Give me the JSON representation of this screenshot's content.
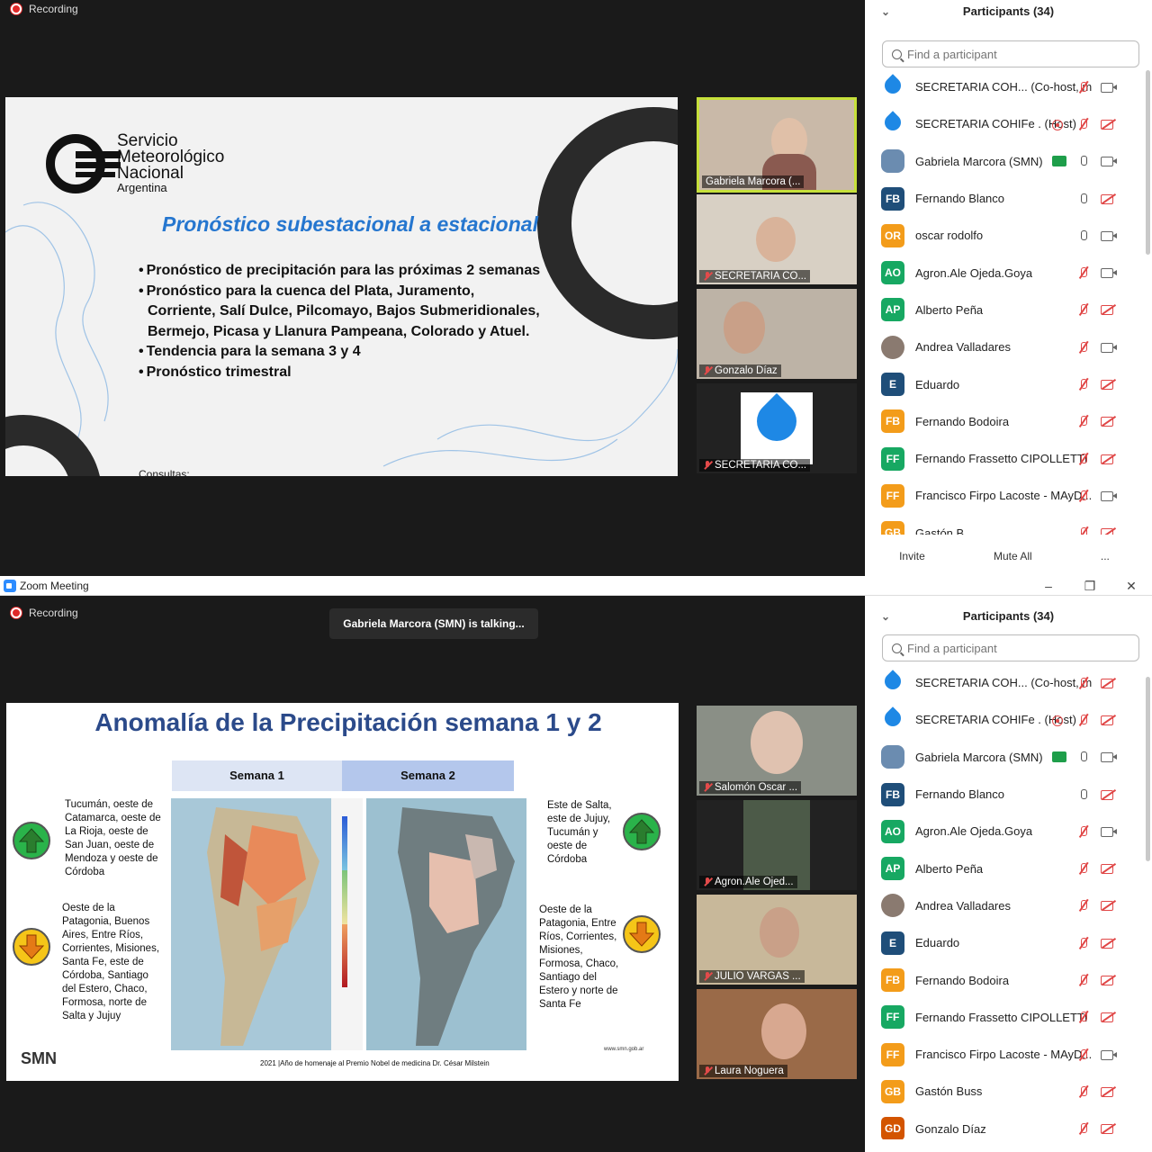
{
  "top": {
    "recording": "Recording",
    "slide": {
      "logo_lines": [
        "Servicio",
        "Meteorológico",
        "Nacional",
        "Argentina"
      ],
      "title": "Pronóstico subestacional a estacional",
      "bullets": [
        "Pronóstico de precipitación para las próximas 2 semanas",
        "Pronóstico para la cuenca del Plata, Juramento, Corriente, Salí Dulce, Pilcomayo, Bajos Submeridionales, Bermejo, Picasa y Llanura Pampeana, Colorado y Atuel.",
        "Tendencia para la semana 3 y 4",
        "Pronóstico trimestral"
      ],
      "footer": "Consultas: ..."
    },
    "tiles": [
      "Gabriela Marcora (...",
      "SECRETARIA CO...",
      "Gonzalo Díaz",
      "SECRETARIA CO..."
    ],
    "panel": {
      "title": "Participants (34)",
      "search_placeholder": "Find a participant",
      "participants": [
        {
          "initials": "",
          "name": "SECRETARIA COH... (Co-host, me)",
          "color": "#1e88e5",
          "avatar": "drop",
          "icons": [
            "micoff",
            "camon"
          ]
        },
        {
          "initials": "",
          "name": "SECRETARIA COHIFe . (Host)",
          "color": "#1e88e5",
          "avatar": "drop",
          "icons": [
            "recd",
            "micoff",
            "camoff"
          ]
        },
        {
          "initials": "",
          "name": "Gabriela Marcora (SMN)",
          "color": "#6b8cb0",
          "avatar": "photo2",
          "icons": [
            "share",
            "micon",
            "camon"
          ]
        },
        {
          "initials": "FB",
          "name": "Fernando Blanco",
          "color": "#1f4e79",
          "avatar": "",
          "icons": [
            "micon",
            "camoff"
          ]
        },
        {
          "initials": "OR",
          "name": "oscar rodolfo",
          "color": "#f39c1a",
          "avatar": "",
          "icons": [
            "micon",
            "camon"
          ]
        },
        {
          "initials": "AO",
          "name": "Agron.Ale Ojeda.Goya",
          "color": "#17a862",
          "avatar": "",
          "icons": [
            "micoff",
            "camon"
          ]
        },
        {
          "initials": "AP",
          "name": "Alberto Peña",
          "color": "#17a862",
          "avatar": "",
          "icons": [
            "micoff",
            "camoff"
          ]
        },
        {
          "initials": "",
          "name": "Andrea Valladares",
          "color": "#8a7a70",
          "avatar": "photo",
          "icons": [
            "micoff",
            "camon"
          ]
        },
        {
          "initials": "E",
          "name": "Eduardo",
          "color": "#1f4e79",
          "avatar": "",
          "icons": [
            "micoff",
            "camoff"
          ]
        },
        {
          "initials": "FB",
          "name": "Fernando Bodoira",
          "color": "#f39c1a",
          "avatar": "",
          "icons": [
            "micoff",
            "camoff"
          ]
        },
        {
          "initials": "FF",
          "name": "Fernando Frassetto CIPOLLETTI",
          "color": "#17a862",
          "avatar": "",
          "icons": [
            "micoff",
            "camoff"
          ]
        },
        {
          "initials": "FF",
          "name": "Francisco Firpo Lacoste - MAyD...",
          "color": "#f39c1a",
          "avatar": "",
          "icons": [
            "micoff",
            "camon"
          ]
        },
        {
          "initials": "GB",
          "name": "Gastón B...",
          "color": "#f39c1a",
          "avatar": "",
          "icons": [
            "micoff",
            "camoff"
          ]
        }
      ],
      "footer": [
        "Invite",
        "Mute All",
        "..."
      ]
    }
  },
  "bottom": {
    "window_title": "Zoom Meeting",
    "recording": "Recording",
    "talking": "Gabriela Marcora (SMN) is talking...",
    "slide": {
      "title": "Anomalía de la Precipitación semana 1 y 2",
      "col1": "Semana 1",
      "col2": "Semana 2",
      "left_up": "Tucumán, oeste de Catamarca, oeste de La Rioja, oeste de San Juan, oeste de Mendoza y oeste de Córdoba",
      "left_down": "Oeste de la Patagonia, Buenos Aires, Entre Ríos, Corrientes, Misiones, Santa Fe, este de Córdoba, Santiago del Estero, Chaco, Formosa, norte de Salta y Jujuy",
      "right_up": "Este de Salta, este de Jujuy, Tucumán y oeste de Córdoba",
      "right_down": "Oeste de la Patagonia, Entre Ríos, Corrientes, Misiones, Formosa, Chaco, Santiago del Estero y norte de Santa Fe",
      "footer": "2021 |Año de homenaje al Premio Nobel de medicina Dr. César Milstein",
      "smn": "SMN",
      "web": "www.smn.gob.ar"
    },
    "tiles": [
      "Salomón Oscar ...",
      "Agron.Ale Ojed...",
      "JULIO VARGAS ...",
      "Laura Noguera"
    ],
    "panel": {
      "title": "Participants (34)",
      "search_placeholder": "Find a participant",
      "participants": [
        {
          "initials": "",
          "name": "SECRETARIA COH... (Co-host, me)",
          "color": "#1e88e5",
          "avatar": "drop",
          "icons": [
            "micoff",
            "camoff"
          ]
        },
        {
          "initials": "",
          "name": "SECRETARIA COHIFe . (Host)",
          "color": "#1e88e5",
          "avatar": "drop",
          "icons": [
            "recd",
            "micoff",
            "camoff"
          ]
        },
        {
          "initials": "",
          "name": "Gabriela Marcora (SMN)",
          "color": "#6b8cb0",
          "avatar": "photo2",
          "icons": [
            "share",
            "micon",
            "camon"
          ]
        },
        {
          "initials": "FB",
          "name": "Fernando Blanco",
          "color": "#1f4e79",
          "avatar": "",
          "icons": [
            "micon",
            "camoff"
          ]
        },
        {
          "initials": "AO",
          "name": "Agron.Ale Ojeda.Goya",
          "color": "#17a862",
          "avatar": "",
          "icons": [
            "micoff",
            "camon"
          ]
        },
        {
          "initials": "AP",
          "name": "Alberto Peña",
          "color": "#17a862",
          "avatar": "",
          "icons": [
            "micoff",
            "camoff"
          ]
        },
        {
          "initials": "",
          "name": "Andrea Valladares",
          "color": "#8a7a70",
          "avatar": "photo",
          "icons": [
            "micoff",
            "camoff"
          ]
        },
        {
          "initials": "E",
          "name": "Eduardo",
          "color": "#1f4e79",
          "avatar": "",
          "icons": [
            "micoff",
            "camoff"
          ]
        },
        {
          "initials": "FB",
          "name": "Fernando Bodoira",
          "color": "#f39c1a",
          "avatar": "",
          "icons": [
            "micoff",
            "camoff"
          ]
        },
        {
          "initials": "FF",
          "name": "Fernando Frassetto CIPOLLETTI",
          "color": "#17a862",
          "avatar": "",
          "icons": [
            "micoff",
            "camoff"
          ]
        },
        {
          "initials": "FF",
          "name": "Francisco Firpo Lacoste - MAyD...",
          "color": "#f39c1a",
          "avatar": "",
          "icons": [
            "micoff",
            "camon"
          ]
        },
        {
          "initials": "GB",
          "name": "Gastón Buss",
          "color": "#f39c1a",
          "avatar": "",
          "icons": [
            "micoff",
            "camoff"
          ]
        },
        {
          "initials": "GD",
          "name": "Gonzalo Díaz",
          "color": "#d35400",
          "avatar": "",
          "icons": [
            "micoff",
            "camoff"
          ]
        }
      ]
    }
  }
}
